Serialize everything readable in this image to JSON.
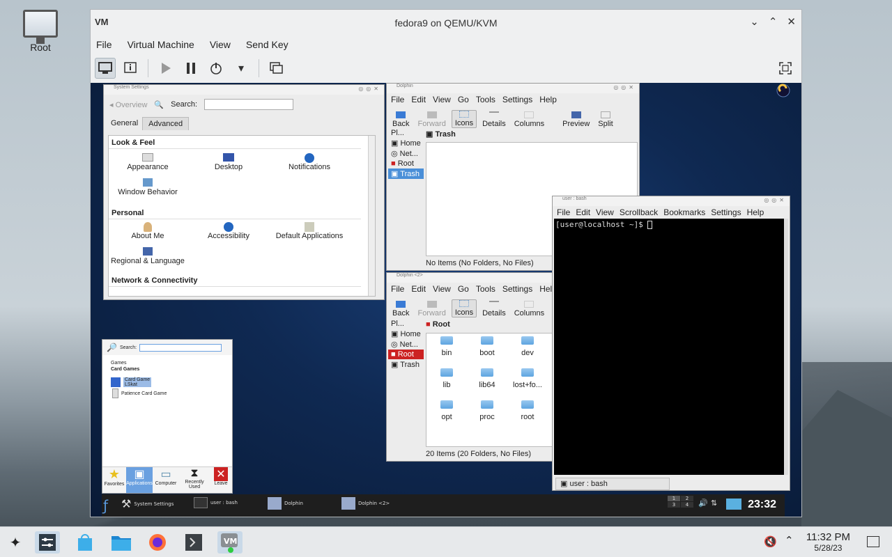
{
  "desktop": {
    "icon_label": "Root"
  },
  "vm_window": {
    "title": "fedora9 on QEMU/KVM",
    "logo": "VM",
    "menu": [
      "File",
      "Virtual Machine",
      "View",
      "Send Key"
    ]
  },
  "system_settings": {
    "title": "System Settings",
    "overview": "Overview",
    "search_label": "Search:",
    "tabs": [
      "General",
      "Advanced"
    ],
    "sections": [
      {
        "name": "Look & Feel",
        "items": [
          "Appearance",
          "Desktop",
          "Notifications",
          "Window Behavior"
        ]
      },
      {
        "name": "Personal",
        "items": [
          "About Me",
          "Accessibility",
          "Default Applications",
          "Regional & Language"
        ]
      },
      {
        "name": "Network & Connectivity",
        "items": []
      }
    ]
  },
  "dolphin1": {
    "title": "Dolphin",
    "menu": [
      "File",
      "Edit",
      "View",
      "Go",
      "Tools",
      "Settings",
      "Help"
    ],
    "toolbar": [
      "Back",
      "Forward",
      "Icons",
      "Details",
      "Columns",
      "Preview",
      "Split"
    ],
    "places_label": "Pl...",
    "places": [
      "Home",
      "Net...",
      "Root",
      "Trash"
    ],
    "location": "Trash",
    "status": "No Items (No Folders, No Files)"
  },
  "dolphin2": {
    "title": "Dolphin <2>",
    "menu": [
      "File",
      "Edit",
      "View",
      "Go",
      "Tools",
      "Settings",
      "Help"
    ],
    "toolbar": [
      "Back",
      "Forward",
      "Icons",
      "Details",
      "Columns"
    ],
    "places_label": "Pl...",
    "places": [
      "Home",
      "Net...",
      "Root",
      "Trash"
    ],
    "location": "Root",
    "folders": [
      "bin",
      "boot",
      "dev",
      "lib",
      "lib64",
      "lost+fo...",
      "opt",
      "proc",
      "root"
    ],
    "status": "20 Items (20 Folders, No Files)"
  },
  "konsole": {
    "title": "user : bash",
    "menu": [
      "File",
      "Edit",
      "View",
      "Scrollback",
      "Bookmarks",
      "Settings",
      "Help"
    ],
    "prompt": "[user@localhost ~]$ ",
    "tab": "user : bash"
  },
  "kickoff": {
    "search_label": "Search:",
    "breadcrumb": "Games",
    "category": "Card Games",
    "items": [
      {
        "name": "Card Game",
        "sub": "LSkat"
      },
      {
        "name": "Patience Card Game",
        "sub": ""
      }
    ],
    "tabs": [
      "Favorites",
      "Applications",
      "Computer",
      "Recently Used",
      "Leave"
    ]
  },
  "guest_taskbar": {
    "tasks": [
      "System Settings",
      "user : bash",
      "Dolphin",
      "Dolphin <2>"
    ],
    "pager": [
      "1",
      "2",
      "3",
      "4"
    ],
    "clock": "23:32"
  },
  "host_taskbar": {
    "time": "11:32 PM",
    "date": "5/28/23"
  },
  "colors": {
    "accent": "#4a8fd8",
    "guest_bg": "#0f2952",
    "terminal_bg": "#000000"
  }
}
